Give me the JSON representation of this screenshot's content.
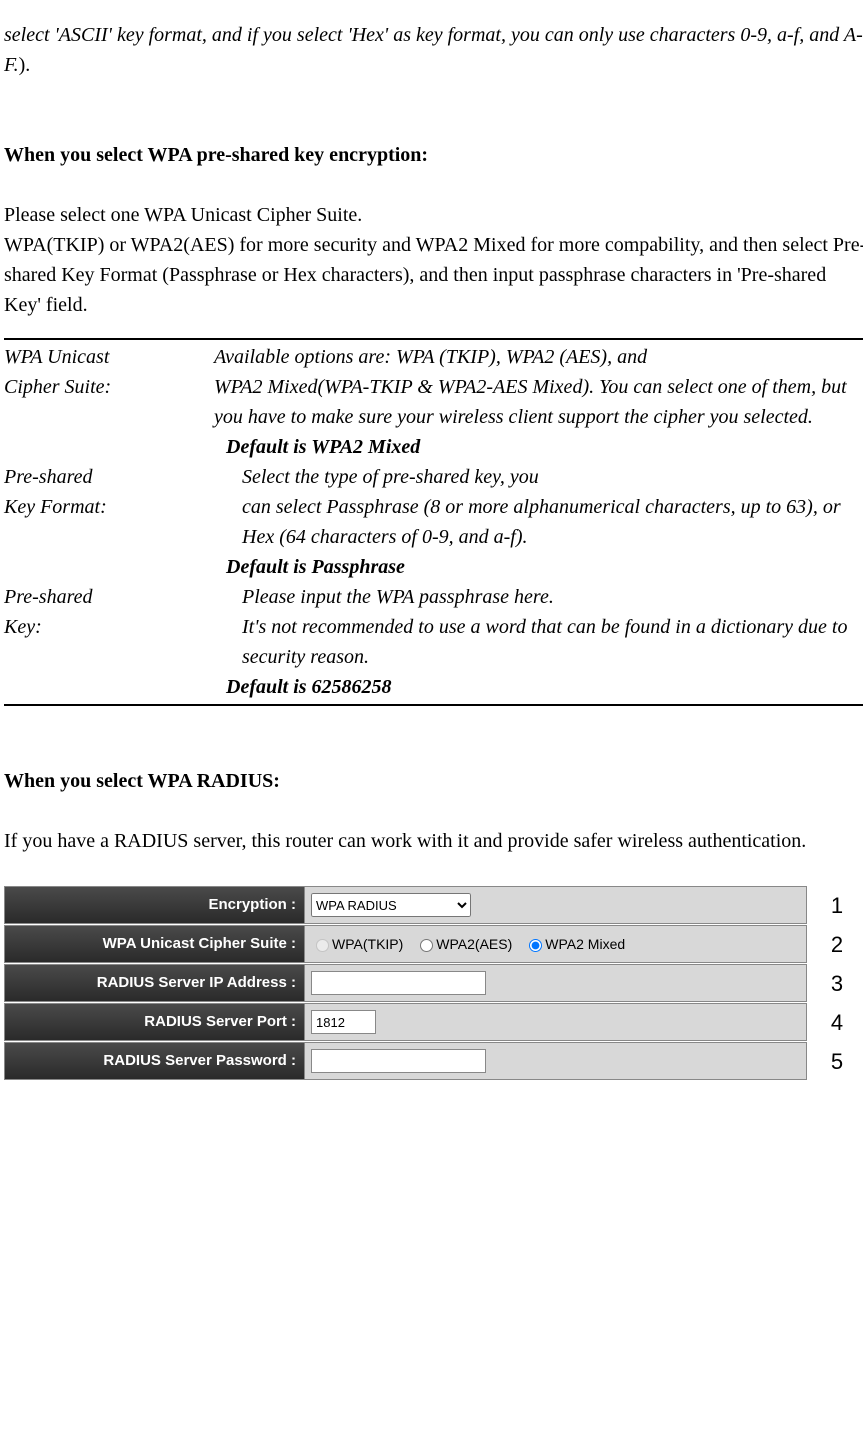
{
  "intro_italic": "select 'ASCII' key format, and if you select 'Hex' as key format, you can only use characters 0-9, a-f, and A-F.",
  "intro_close": ").",
  "psk": {
    "heading": "When you select WPA pre-shared key encryption:",
    "para1": "Please select one WPA Unicast Cipher Suite.",
    "para2": "WPA(TKIP) or WPA2(AES) for more security and WPA2 Mixed for more compability, and then select Pre-shared Key Format (Passphrase or Hex characters), and then input passphrase characters in 'Pre-shared Key' field.",
    "rows": [
      {
        "term1": "WPA Unicast",
        "term2": "Cipher Suite:",
        "desc1": "Available options are: WPA (TKIP), WPA2 (AES), and",
        "desc2": "WPA2 Mixed(WPA-TKIP & WPA2-AES Mixed). You can select one of them, but you have to make sure your wireless client support the cipher you selected.",
        "default": "Default is WPA2 Mixed"
      },
      {
        "term1": "Pre-shared",
        "term2": "Key Format:",
        "desc1": "Select the type of pre-shared key, you",
        "desc2": "can select Passphrase (8 or more alphanumerical characters, up to 63), or Hex (64 characters of 0-9, and a-f).",
        "default": "Default is Passphrase"
      },
      {
        "term1": "Pre-shared",
        "term2": "Key:",
        "desc1": "Please input the WPA passphrase here.",
        "desc2": "It's not recommended to use a word that can be found in a dictionary due to security reason.",
        "default": "Default is 62586258"
      }
    ]
  },
  "radius": {
    "heading": "When you select WPA RADIUS:",
    "para": "If you have a RADIUS server, this router can work with it and provide safer wireless authentication.",
    "form": {
      "encryption_label": "Encryption :",
      "encryption_value": "WPA RADIUS",
      "cipher_label": "WPA Unicast Cipher Suite :",
      "cipher_opt1": "WPA(TKIP)",
      "cipher_opt2": "WPA2(AES)",
      "cipher_opt3": "WPA2 Mixed",
      "ip_label": "RADIUS Server IP Address :",
      "ip_value": "",
      "port_label": "RADIUS Server Port :",
      "port_value": "1812",
      "pwd_label": "RADIUS Server Password :",
      "pwd_value": ""
    },
    "nums": [
      "1",
      "2",
      "3",
      "4",
      "5"
    ]
  }
}
